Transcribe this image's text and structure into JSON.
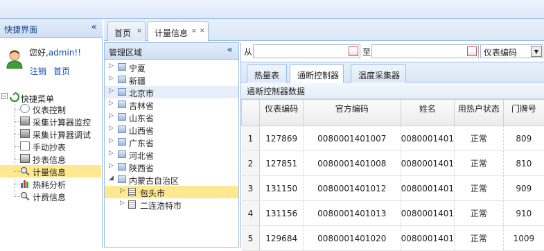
{
  "sidebar": {
    "title": "快捷界面",
    "collapse_icon": "«",
    "welcome_prefix": "您好,",
    "username": "admin!!",
    "logout": "注销",
    "home": "首页",
    "menu_root": "快捷菜单",
    "menu": [
      {
        "label": "仪表控制",
        "icon": "meter-control-icon"
      },
      {
        "label": "采集计算器监控",
        "icon": "collector-monitor-icon"
      },
      {
        "label": "采集计算器调试",
        "icon": "collector-debug-icon"
      },
      {
        "label": "手动抄表",
        "icon": "manual-read-icon"
      },
      {
        "label": "抄表信息",
        "icon": "read-info-icon"
      },
      {
        "label": "计量信息",
        "icon": "magnifier-icon",
        "selected": true
      },
      {
        "label": "热耗分析",
        "icon": "bar-chart-icon"
      },
      {
        "label": "计费信息",
        "icon": "magnifier-icon"
      }
    ]
  },
  "tabs": [
    {
      "label": "首页",
      "close": "¤"
    },
    {
      "label": "计量信息",
      "close": "¤",
      "x": "✕"
    }
  ],
  "mgmt": {
    "title": "管理区域",
    "collapse_icon": "«",
    "nodes": [
      {
        "label": "宁夏",
        "exp": "▷"
      },
      {
        "label": "新疆",
        "exp": "▷"
      },
      {
        "label": "北京市",
        "exp": "▷"
      },
      {
        "label": "吉林省",
        "exp": "▷"
      },
      {
        "label": "山东省",
        "exp": "▷"
      },
      {
        "label": "山西省",
        "exp": "▷"
      },
      {
        "label": "广东省",
        "exp": "▷"
      },
      {
        "label": "河北省",
        "exp": "▷"
      },
      {
        "label": "陕西省",
        "exp": "▷"
      },
      {
        "label": "内蒙古自治区",
        "exp": "◢"
      }
    ],
    "children": [
      {
        "label": "包头市",
        "exp": "▷"
      },
      {
        "label": "二连浩特市",
        "exp": "▷"
      }
    ]
  },
  "filter": {
    "from_label": "从",
    "to_label": "至",
    "select_value": "仪表编码",
    "select_arrow": "▼"
  },
  "subtabs": [
    "热量表",
    "通断控制器",
    "温度采集器"
  ],
  "grid": {
    "title": "通断控制器数据",
    "columns": [
      "",
      "仪表编码",
      "官方编码",
      "姓名",
      "用热户状态",
      "门牌号"
    ],
    "rows": [
      [
        "1",
        "127869",
        "0080001401007",
        "0080001401",
        "正常",
        "809"
      ],
      [
        "2",
        "127851",
        "0080001401008",
        "0080001401",
        "正常",
        "810"
      ],
      [
        "3",
        "131150",
        "0080001401012",
        "0080001401",
        "正常",
        "909"
      ],
      [
        "4",
        "131156",
        "0080001401013",
        "0080001401",
        "正常",
        "910"
      ],
      [
        "5",
        "129684",
        "0080001401020",
        "0080001401",
        "正常",
        "1009"
      ]
    ]
  },
  "colors": {
    "accent": "#15428b",
    "selection": "#ffe88f",
    "border": "#99bbe8"
  }
}
